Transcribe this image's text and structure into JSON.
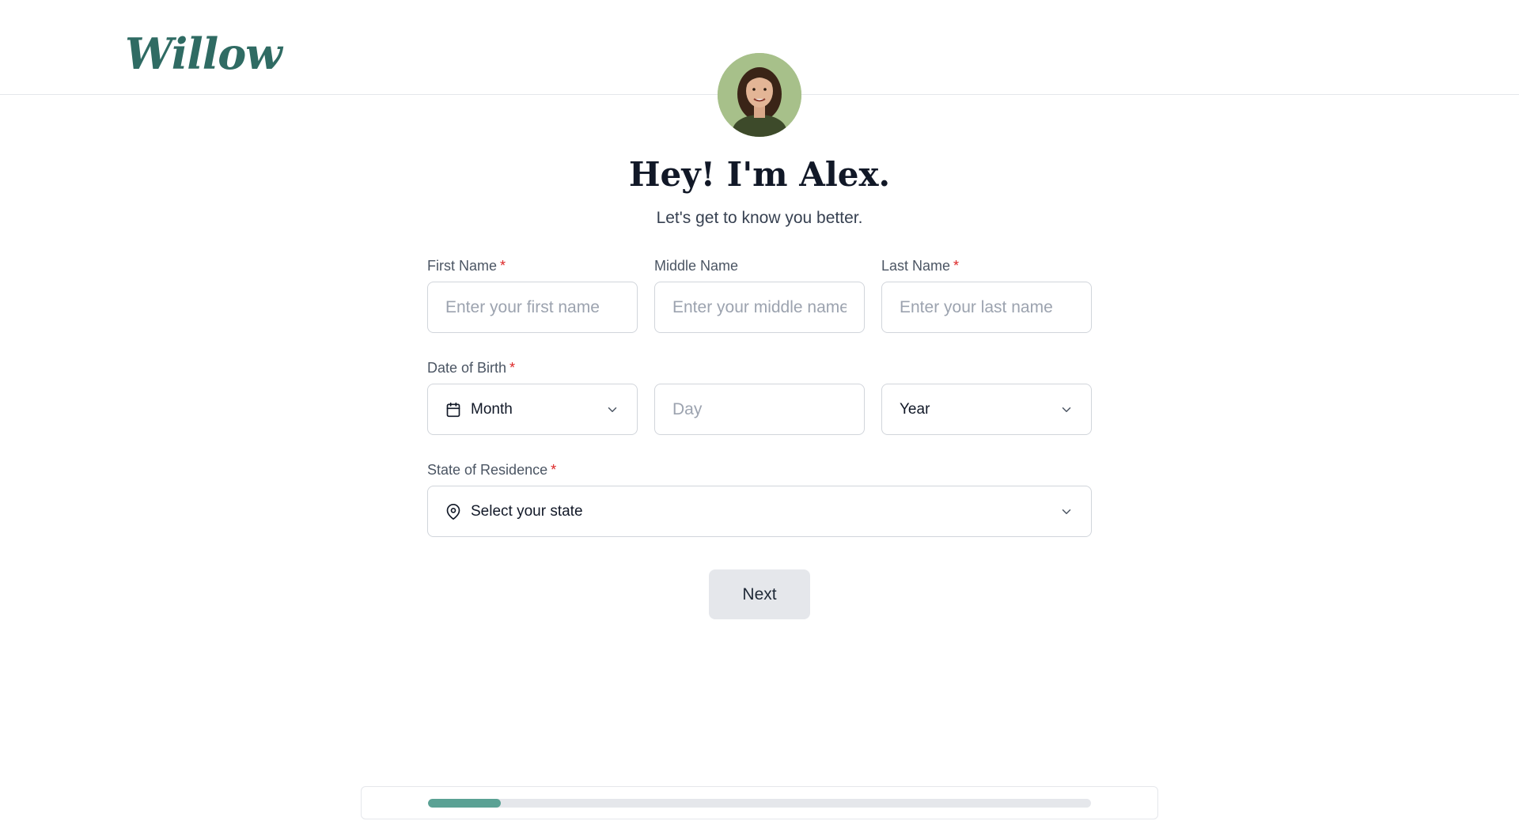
{
  "brand": {
    "logo_text": "Willow",
    "accent": "#2f6b63"
  },
  "header": {
    "avatar_alt": "Alex"
  },
  "intro": {
    "title": "Hey! I'm Alex.",
    "subtitle": "Let's get to know you better."
  },
  "form": {
    "first_name": {
      "label": "First Name",
      "required_mark": "*",
      "placeholder": "Enter your first name",
      "value": ""
    },
    "middle_name": {
      "label": "Middle Name",
      "placeholder": "Enter your middle name",
      "value": ""
    },
    "last_name": {
      "label": "Last Name",
      "required_mark": "*",
      "placeholder": "Enter your last name",
      "value": ""
    },
    "dob": {
      "label": "Date of Birth",
      "required_mark": "*",
      "month": {
        "value": "Month",
        "icon": "calendar-icon"
      },
      "day": {
        "placeholder": "Day"
      },
      "year": {
        "value": "Year"
      }
    },
    "state": {
      "label": "State of Residence",
      "required_mark": "*",
      "value": "Select your state",
      "icon": "map-pin-icon"
    }
  },
  "actions": {
    "next_label": "Next"
  },
  "progress": {
    "fraction": 0.11,
    "fill_color": "#5aa194"
  }
}
